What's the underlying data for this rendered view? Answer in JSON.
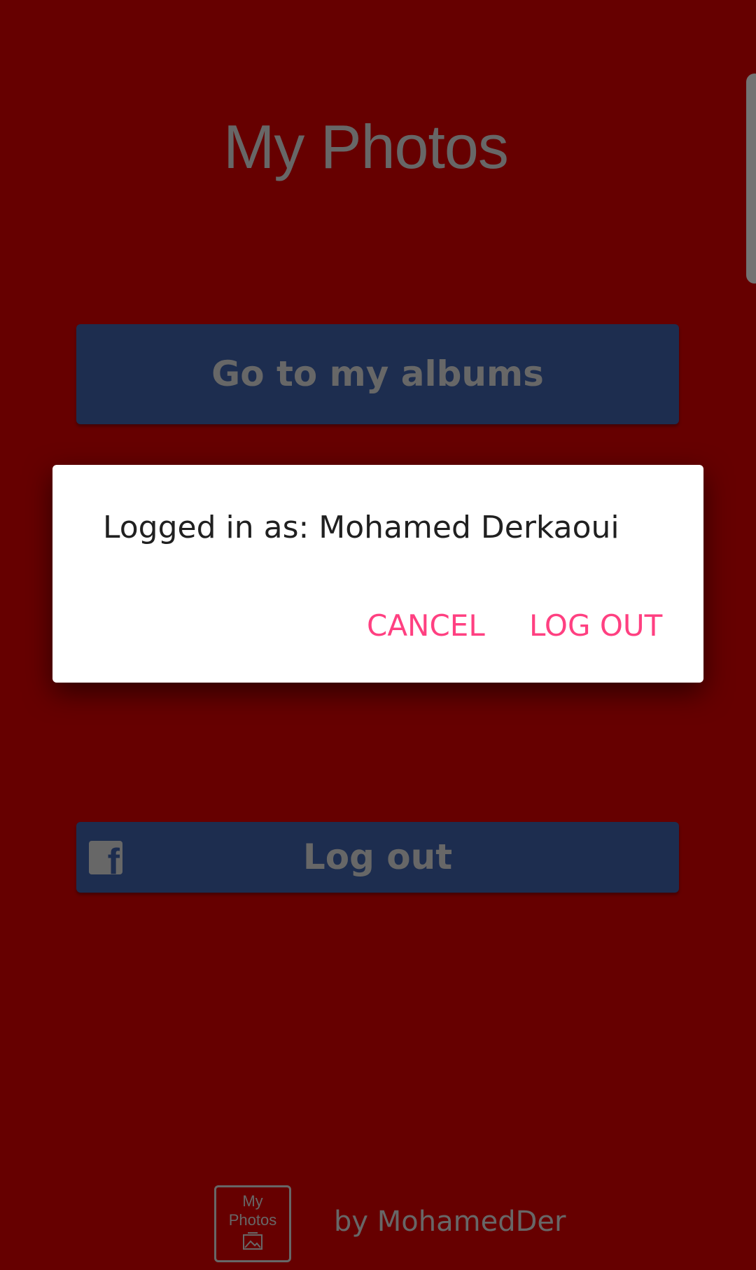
{
  "app": {
    "title": "My Photos"
  },
  "main": {
    "albums_button_label": "Go to my albums",
    "logout_button_label": "Log out"
  },
  "footer": {
    "logo_line1": "My",
    "logo_line2": "Photos",
    "byline": "by MohamedDer"
  },
  "dialog": {
    "message": "Logged in as: Mohamed Derkaoui",
    "cancel_label": "CANCEL",
    "logout_label": "LOG OUT"
  },
  "colors": {
    "background": "#cc0000",
    "button": "#3a5a9f",
    "accent": "#ff4081"
  },
  "icons": {
    "facebook": "facebook-icon",
    "picture": "picture-icon"
  }
}
